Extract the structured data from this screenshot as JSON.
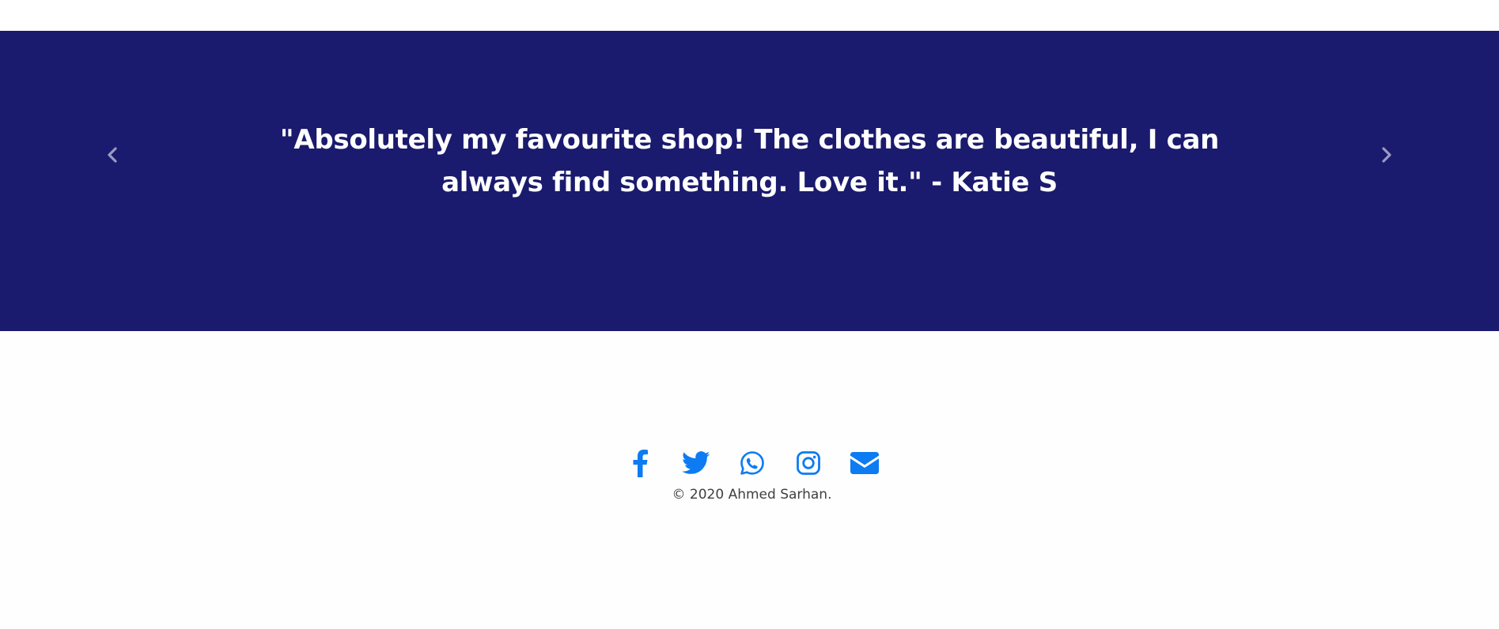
{
  "testimonial": {
    "quote": "\"Absolutely my favourite shop! The clothes are beautiful, I can always find something. Love it.\" - Katie S",
    "background_color": "#1a1a6e",
    "prev_icon": "chevron-left-icon",
    "next_icon": "chevron-right-icon"
  },
  "footer": {
    "accent_color": "#0d7bf2",
    "social_links": [
      {
        "icon": "facebook-icon"
      },
      {
        "icon": "twitter-icon"
      },
      {
        "icon": "whatsapp-icon"
      },
      {
        "icon": "instagram-icon"
      },
      {
        "icon": "envelope-icon"
      }
    ],
    "copyright": "© 2020 Ahmed Sarhan."
  }
}
